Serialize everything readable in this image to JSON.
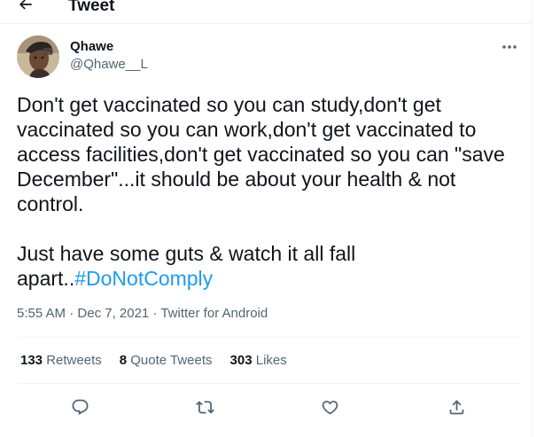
{
  "header": {
    "title": "Tweet"
  },
  "author": {
    "name": "Qhawe",
    "handle": "@Qhawe__L"
  },
  "tweet": {
    "text": "Don't get vaccinated so you can study,don't get\nvaccinated so you can work,don't get vaccinated to\naccess facilities,don't get vaccinated so you can \"save\nDecember\"...it should be about your health & not\ncontrol.\n\nJust have some guts & watch it all fall\napart..",
    "hashtag": "#DoNotComply"
  },
  "meta": {
    "time": "5:55 AM",
    "separator1": " · ",
    "date": "Dec 7, 2021",
    "separator2": " · ",
    "source": "Twitter for Android"
  },
  "stats": {
    "retweets_count": "133",
    "retweets_label": "Retweets",
    "quotes_count": "8",
    "quotes_label": "Quote Tweets",
    "likes_count": "303",
    "likes_label": "Likes"
  },
  "icons": {
    "back": "arrow-left-icon",
    "more": "more-horizontal-icon",
    "reply": "reply-icon",
    "retweet": "retweet-icon",
    "like": "heart-icon",
    "share": "share-icon"
  },
  "colors": {
    "accent": "#1d9bf0",
    "text": "#0f1419",
    "secondary": "#536471",
    "border": "#eff3f4"
  }
}
